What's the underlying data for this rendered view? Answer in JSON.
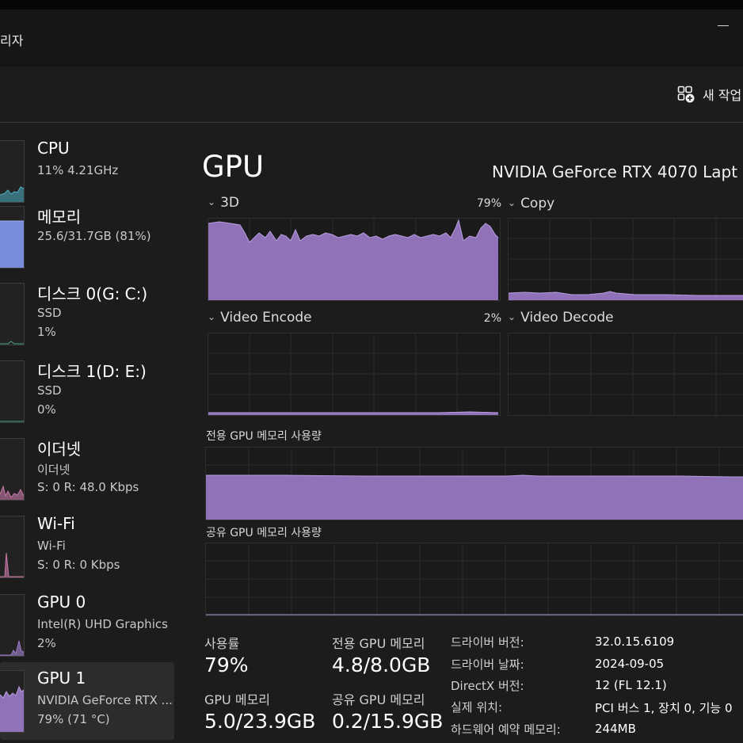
{
  "window": {
    "title": "리자"
  },
  "toolbar": {
    "new_task_label": "새 작업"
  },
  "colors": {
    "cpu": "#4fb0c6",
    "memory": "#7a8cdc",
    "disk": "#4aa87c",
    "network": "#c879a8",
    "gpu": "#9b7cc8",
    "gpu_fill": "#8f72b8",
    "background": "#1c1c1c"
  },
  "sidebar": {
    "items": [
      {
        "name": "CPU",
        "line1": "11% 4.21GHz",
        "line2": ""
      },
      {
        "name": "메모리",
        "line1": "25.6/31.7GB (81%)",
        "line2": ""
      },
      {
        "name": "디스크 0(G: C:)",
        "line1": "SSD",
        "line2": "1%"
      },
      {
        "name": "디스크 1(D: E:)",
        "line1": "SSD",
        "line2": "0%"
      },
      {
        "name": "이더넷",
        "line1": "이더넷",
        "line2": "S: 0 R: 48.0 Kbps"
      },
      {
        "name": "Wi-Fi",
        "line1": "Wi-Fi",
        "line2": "S: 0 R: 0 Kbps"
      },
      {
        "name": "GPU 0",
        "line1": "Intel(R) UHD Graphics",
        "line2": "2%"
      },
      {
        "name": "GPU 1",
        "line1": "NVIDIA GeForce RTX ...",
        "line2": "79% (71 °C)"
      }
    ]
  },
  "main": {
    "title": "GPU",
    "model": "NVIDIA GeForce RTX 4070 Lapt",
    "engines": [
      {
        "label": "3D",
        "percent": "79%"
      },
      {
        "label": "Copy",
        "percent": ""
      },
      {
        "label": "Video Encode",
        "percent": "2%"
      },
      {
        "label": "Video Decode",
        "percent": ""
      }
    ],
    "dedicated_label": "전용 GPU 메모리 사용량",
    "shared_label": "공유 GPU 메모리 사용량"
  },
  "stats": {
    "utilization_label": "사용률",
    "utilization_value": "79%",
    "dedicated_label": "전용 GPU 메모리",
    "dedicated_value": "4.8/8.0GB",
    "gpu_memory_label": "GPU 메모리",
    "gpu_memory_value": "5.0/23.9GB",
    "shared_label": "공유 GPU 메모리",
    "shared_value": "0.2/15.9GB"
  },
  "info": [
    {
      "label": "드라이버 버전:",
      "value": "32.0.15.6109"
    },
    {
      "label": "드라이버 날짜:",
      "value": "2024-09-05"
    },
    {
      "label": "DirectX 버전:",
      "value": "12 (FL 12.1)"
    },
    {
      "label": "실제 위치:",
      "value": "PCI 버스 1, 장치 0, 기능 0"
    },
    {
      "label": "하드웨어 예약 메모리:",
      "value": "244MB"
    }
  ]
}
